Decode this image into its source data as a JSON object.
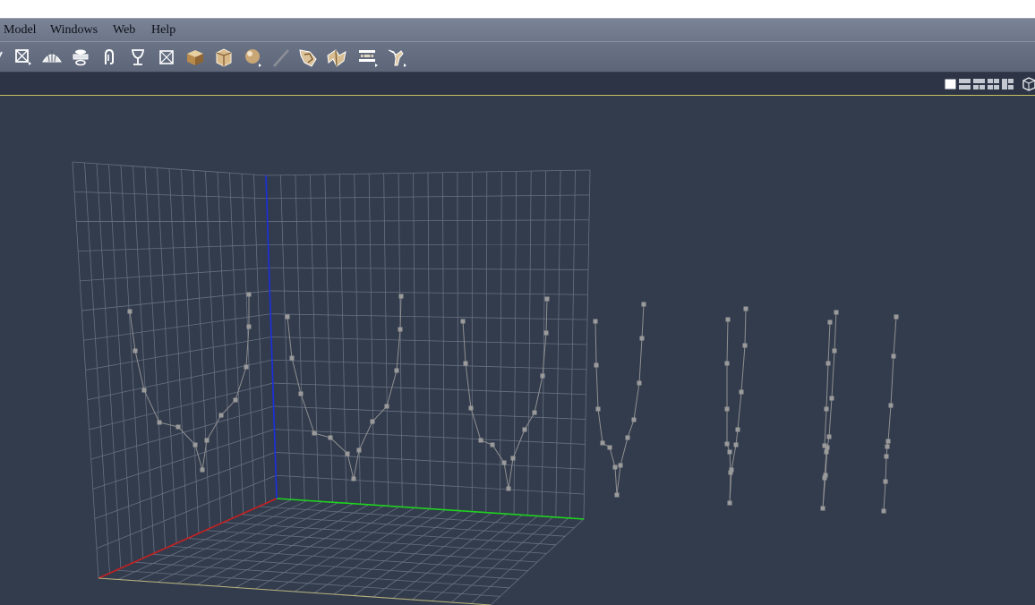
{
  "menu": {
    "items": [
      "Model",
      "Windows",
      "Web",
      "Help"
    ]
  },
  "toolbar": {
    "tools": [
      "arrow-tool-icon",
      "transform-box-icon",
      "dome-icon",
      "lathe-icon",
      "clip-icon",
      "goblet-icon",
      "box-wireframe-icon",
      "cube-icon",
      "bag-icon",
      "sphere-icon",
      "slash-icon",
      "spring-icon",
      "twist-icon",
      "stack-icon",
      "bend-icon"
    ]
  },
  "viewbar": {
    "layouts": [
      "single-view-icon",
      "two-horizontal-views-icon",
      "two-vertical-views-icon",
      "four-views-icon",
      "three-views-icon"
    ],
    "active_layout": 0,
    "camera_icon": "camera-icon"
  },
  "colors": {
    "viewport_bg": "#333c4d",
    "grid": "#66707f",
    "x_axis": "#c62020",
    "y_axis": "#1fd21f",
    "z_axis": "#1a2fe0",
    "curve": "#909090",
    "control_point": "#9a9a9a",
    "active_layout": "#ffffff",
    "inactive_layout": "#c4c8d0"
  }
}
